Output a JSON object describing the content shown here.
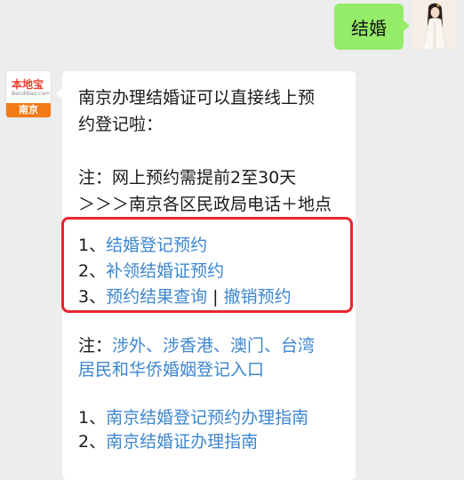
{
  "outgoing": {
    "text": "结婚"
  },
  "bot": {
    "logo_main": "本地宝",
    "logo_sub": "Bendibao.com",
    "logo_city": "南京"
  },
  "message": {
    "intro_line1": "南京办理结婚证可以直接线上预",
    "intro_line2": "约登记啦：",
    "note_line1": "注：网上预约需提前2至30天",
    "note_line2": "＞＞＞南京各区民政局电话＋地点",
    "links": [
      {
        "prefix": "1、",
        "text": "结婚登记预约"
      },
      {
        "prefix": "2、",
        "text": "补领结婚证预约"
      },
      {
        "prefix": "3、",
        "text": "预约结果查询",
        "sep": " | ",
        "text2": "撤销预约"
      }
    ],
    "foreign_prefix": "注：",
    "foreign_line1": "涉外、涉香港、澳门、台湾",
    "foreign_line2": "居民和华侨婚姻登记入口",
    "guides": [
      {
        "prefix": "1、",
        "text": "南京结婚登记预约办理指南"
      },
      {
        "prefix": "2、",
        "text": "南京结婚证办理指南"
      }
    ]
  },
  "colors": {
    "outgoing_bubble": "#95ec69",
    "link": "#3d86cf",
    "highlight_border": "#e9262f",
    "background": "#ededed"
  }
}
